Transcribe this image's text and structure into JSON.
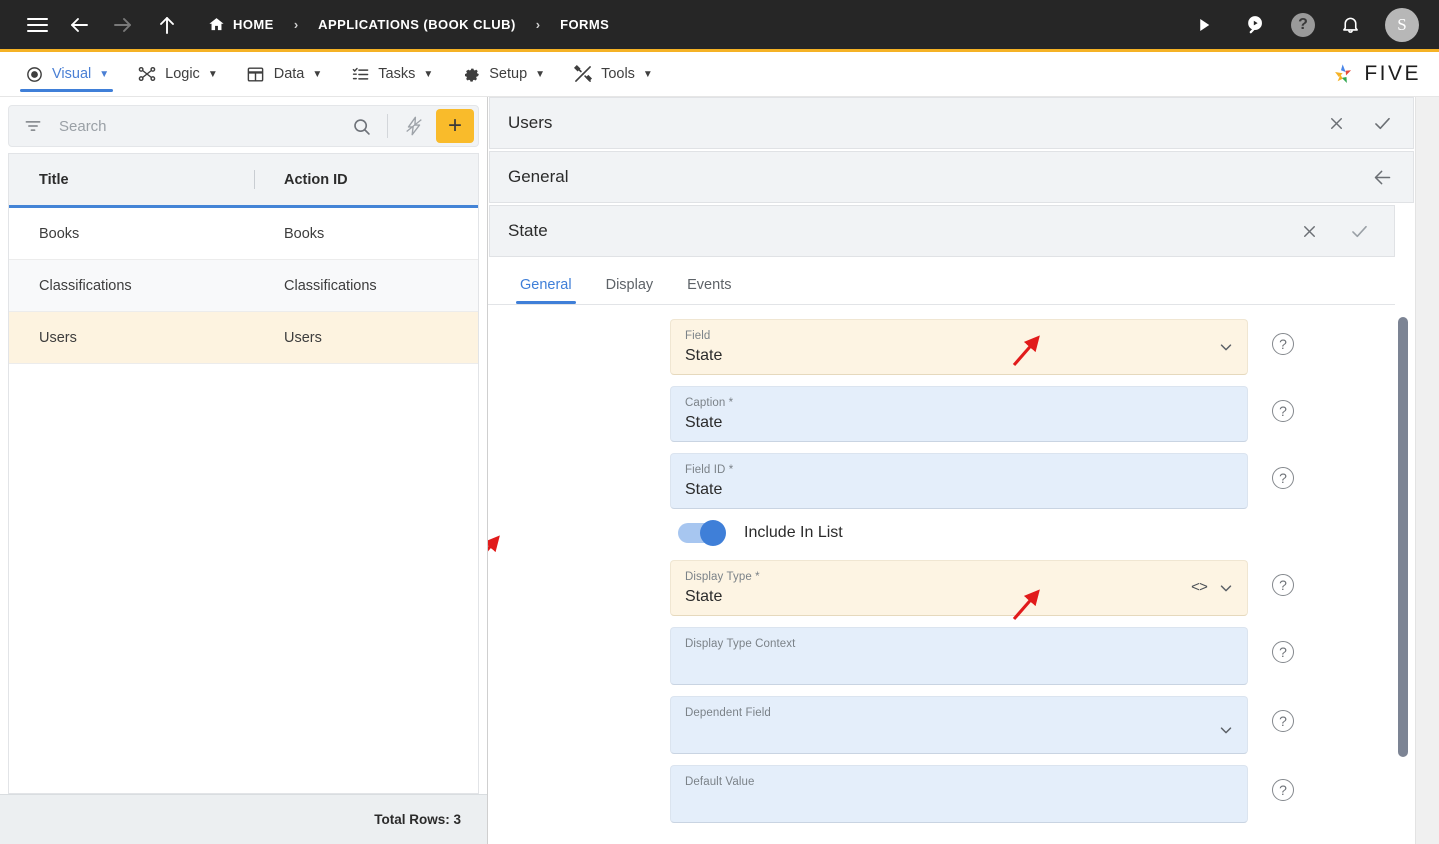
{
  "topbar": {
    "menu_icon": "hamburger-icon",
    "back_icon": "arrow-left-icon",
    "forward_icon": "arrow-right-icon",
    "up_icon": "arrow-up-icon",
    "breadcrumbs": [
      {
        "label": "HOME",
        "icon": "home-icon"
      },
      {
        "label": "APPLICATIONS (BOOK CLUB)",
        "icon": ""
      },
      {
        "label": "FORMS",
        "icon": ""
      }
    ],
    "separator": "›",
    "run_icon": "play-icon",
    "search_icon": "search-play-icon",
    "help_icon": "help-circle-icon",
    "help_glyph": "?",
    "bell_icon": "bell-icon",
    "avatar_initial": "S"
  },
  "menubar": {
    "items": [
      {
        "label": "Visual",
        "icon": "eye-icon",
        "caret": "▼",
        "active": true
      },
      {
        "label": "Logic",
        "icon": "logic-nodes-icon",
        "caret": "▼",
        "active": false
      },
      {
        "label": "Data",
        "icon": "table-grid-icon",
        "caret": "▼",
        "active": false
      },
      {
        "label": "Tasks",
        "icon": "checklist-icon",
        "caret": "▼",
        "active": false
      },
      {
        "label": "Setup",
        "icon": "gear-icon",
        "caret": "▼",
        "active": false
      },
      {
        "label": "Tools",
        "icon": "tools-icon",
        "caret": "▼",
        "active": false
      }
    ],
    "brand": "FIVE"
  },
  "left_panel": {
    "search": {
      "placeholder": "Search",
      "value": "",
      "filter_icon": "filter-icon",
      "search_icon": "search-icon",
      "lightning_icon": "lightning-disabled-icon",
      "add_label": "+"
    },
    "table": {
      "columns": [
        "Title",
        "Action ID"
      ],
      "rows": [
        {
          "title": "Books",
          "action_id": "Books",
          "selected": false
        },
        {
          "title": "Classifications",
          "action_id": "Classifications",
          "selected": false
        },
        {
          "title": "Users",
          "action_id": "Users",
          "selected": true
        }
      ]
    },
    "footer": "Total Rows: 3"
  },
  "right_panel": {
    "sections": [
      {
        "title": "Users",
        "actions": [
          "close-icon",
          "confirm-icon"
        ]
      },
      {
        "title": "General",
        "actions": [
          "arrow-left-icon"
        ]
      },
      {
        "title": "State",
        "actions": [
          "close-icon",
          "confirm-icon"
        ]
      }
    ],
    "tabs": [
      {
        "label": "General",
        "active": true
      },
      {
        "label": "Display",
        "active": false
      },
      {
        "label": "Events",
        "active": false
      }
    ],
    "fields": [
      {
        "label": "Field",
        "value": "State",
        "highlighted": true,
        "chevron": true,
        "code_icon": false,
        "help": "?"
      },
      {
        "label": "Caption *",
        "value": "State",
        "highlighted": false,
        "chevron": false,
        "code_icon": false,
        "help": "?"
      },
      {
        "label": "Field ID *",
        "value": "State",
        "highlighted": false,
        "chevron": false,
        "code_icon": false,
        "help": "?"
      }
    ],
    "toggle": {
      "label": "Include In List",
      "checked": true,
      "help": "?"
    },
    "fields2": [
      {
        "label": "Display Type *",
        "value": "State",
        "highlighted": true,
        "chevron": true,
        "code_icon": true,
        "code_glyph": "<>",
        "help": "?"
      },
      {
        "label": "Display Type Context",
        "value": "",
        "highlighted": false,
        "chevron": false,
        "code_icon": false,
        "help": "?"
      },
      {
        "label": "Dependent Field",
        "value": "",
        "highlighted": false,
        "chevron": true,
        "code_icon": false,
        "help": "?"
      },
      {
        "label": "Default Value",
        "value": "",
        "highlighted": false,
        "chevron": false,
        "code_icon": false,
        "help": "?"
      }
    ]
  },
  "colors": {
    "topbar_bg": "#262626",
    "accent_yellow": "#f5b225",
    "accent_blue": "#3f7fd8",
    "field_blue": "#e4eefa",
    "field_highlight": "#fdf4e3",
    "row_selected": "#fdf3e0",
    "annotation_red": "#e11b1b"
  }
}
